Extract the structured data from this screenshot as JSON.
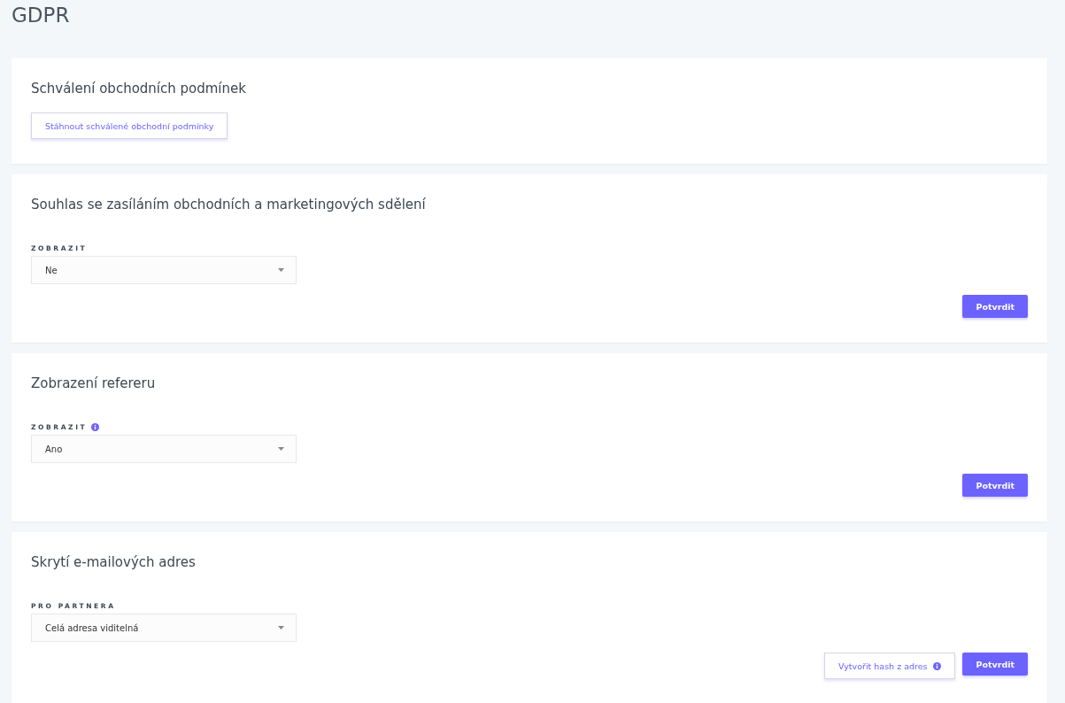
{
  "page_title": "GDPR",
  "sections": [
    {
      "kind": "download",
      "title": "Schválení obchodních podmínek",
      "buttons": [
        {
          "label": "Stáhnout schválené obchodní podmínky",
          "kind": "secondary",
          "info": false
        }
      ]
    },
    {
      "kind": "select",
      "title": "Souhlas se zasíláním obchodních a marketingových sdělení",
      "field": {
        "label": "ZOBRAZIT",
        "info": false,
        "value": "Ne"
      },
      "buttons": [
        {
          "label": "Potvrdit",
          "kind": "primary",
          "info": false
        }
      ]
    },
    {
      "kind": "select",
      "title": "Zobrazení refereru",
      "field": {
        "label": "ZOBRAZIT",
        "info": true,
        "value": "Ano"
      },
      "buttons": [
        {
          "label": "Potvrdit",
          "kind": "primary",
          "info": false
        }
      ]
    },
    {
      "kind": "select",
      "title": "Skrytí e-mailových adres",
      "field": {
        "label": "PRO PARTNERA",
        "info": false,
        "value": "Celá adresa viditelná"
      },
      "buttons": [
        {
          "label": "Vytvořit hash z adres",
          "kind": "secondary",
          "info": true
        },
        {
          "label": "Potvrdit",
          "kind": "primary",
          "info": false
        }
      ]
    }
  ]
}
